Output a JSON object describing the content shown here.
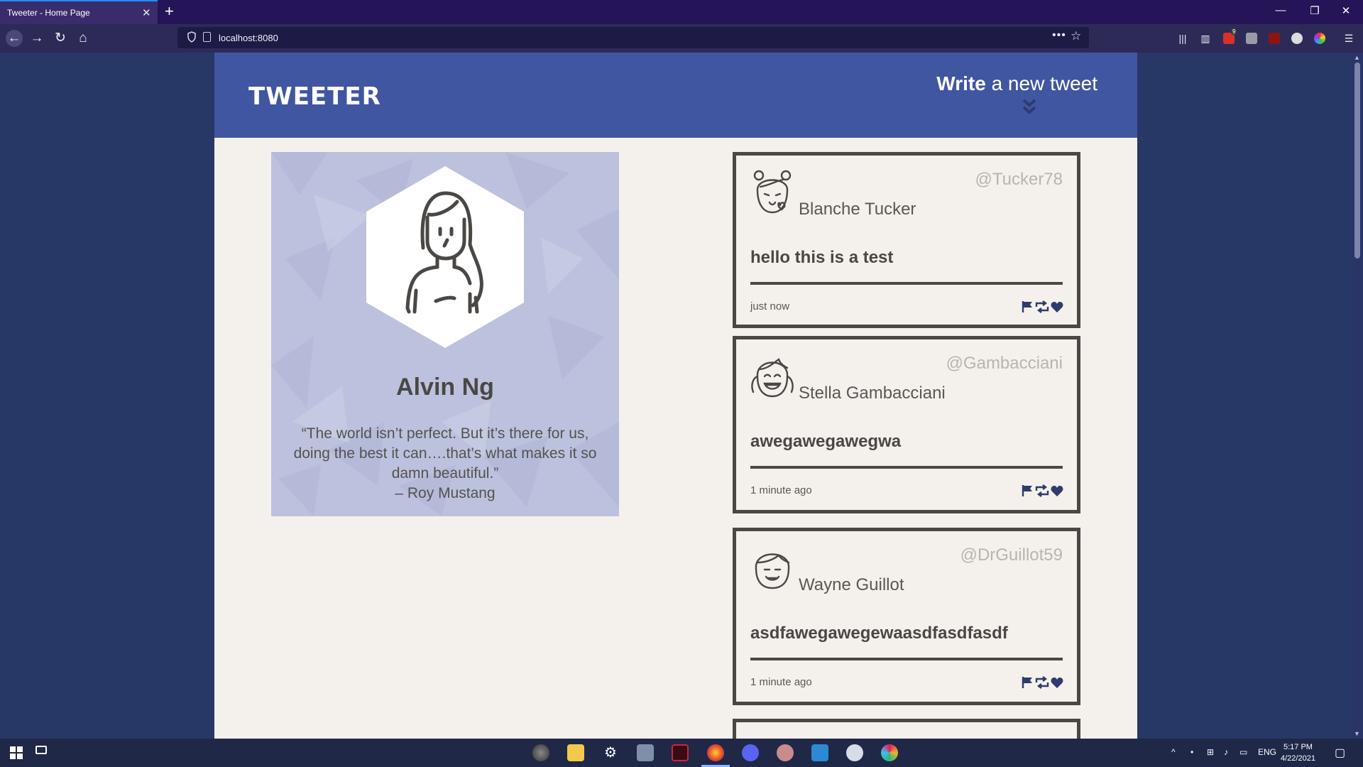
{
  "browser": {
    "tab_title": "Tweeter - Home Page",
    "tab_close": "✕",
    "new_tab": "+",
    "url": "localhost:8080",
    "minimize": "—",
    "restore": "❐",
    "close": "✕",
    "extension_badge": "9"
  },
  "header": {
    "logo": "TWEETER",
    "compose_bold": "Write",
    "compose_rest": " a new tweet"
  },
  "profile": {
    "name": "Alvin Ng",
    "quote_line1": "“The world isn’t perfect. But it’s there for us,",
    "quote_line2": "doing the best it can….that’s what makes it so",
    "quote_line3": "damn beautiful.”",
    "quote_author": "– Roy Mustang"
  },
  "tweets": [
    {
      "handle": "@Tucker78",
      "name": "Blanche Tucker",
      "text": "hello this is a test",
      "time": "just now",
      "avatar": "girl-buns-avatar-icon"
    },
    {
      "handle": "@Gambacciani",
      "name": "Stella Gambacciani",
      "text": "awegawegawegwa",
      "time": "1 minute ago",
      "avatar": "girl-pigtails-avatar-icon"
    },
    {
      "handle": "@DrGuillot59",
      "name": "Wayne Guillot",
      "text": "asdfawegawegewaasdfasdfasdf",
      "time": "1 minute ago",
      "avatar": "boy-avatar-icon"
    }
  ],
  "taskbar": {
    "language": "ENG",
    "time": "5:17 PM",
    "date": "4/22/2021"
  },
  "colors": {
    "header_blue": "#4156a1",
    "page_bg": "#f4f1ec",
    "profile_bg": "#bcc2dd",
    "border_dark": "#4a4744",
    "icon_navy": "#2f3b6d"
  }
}
